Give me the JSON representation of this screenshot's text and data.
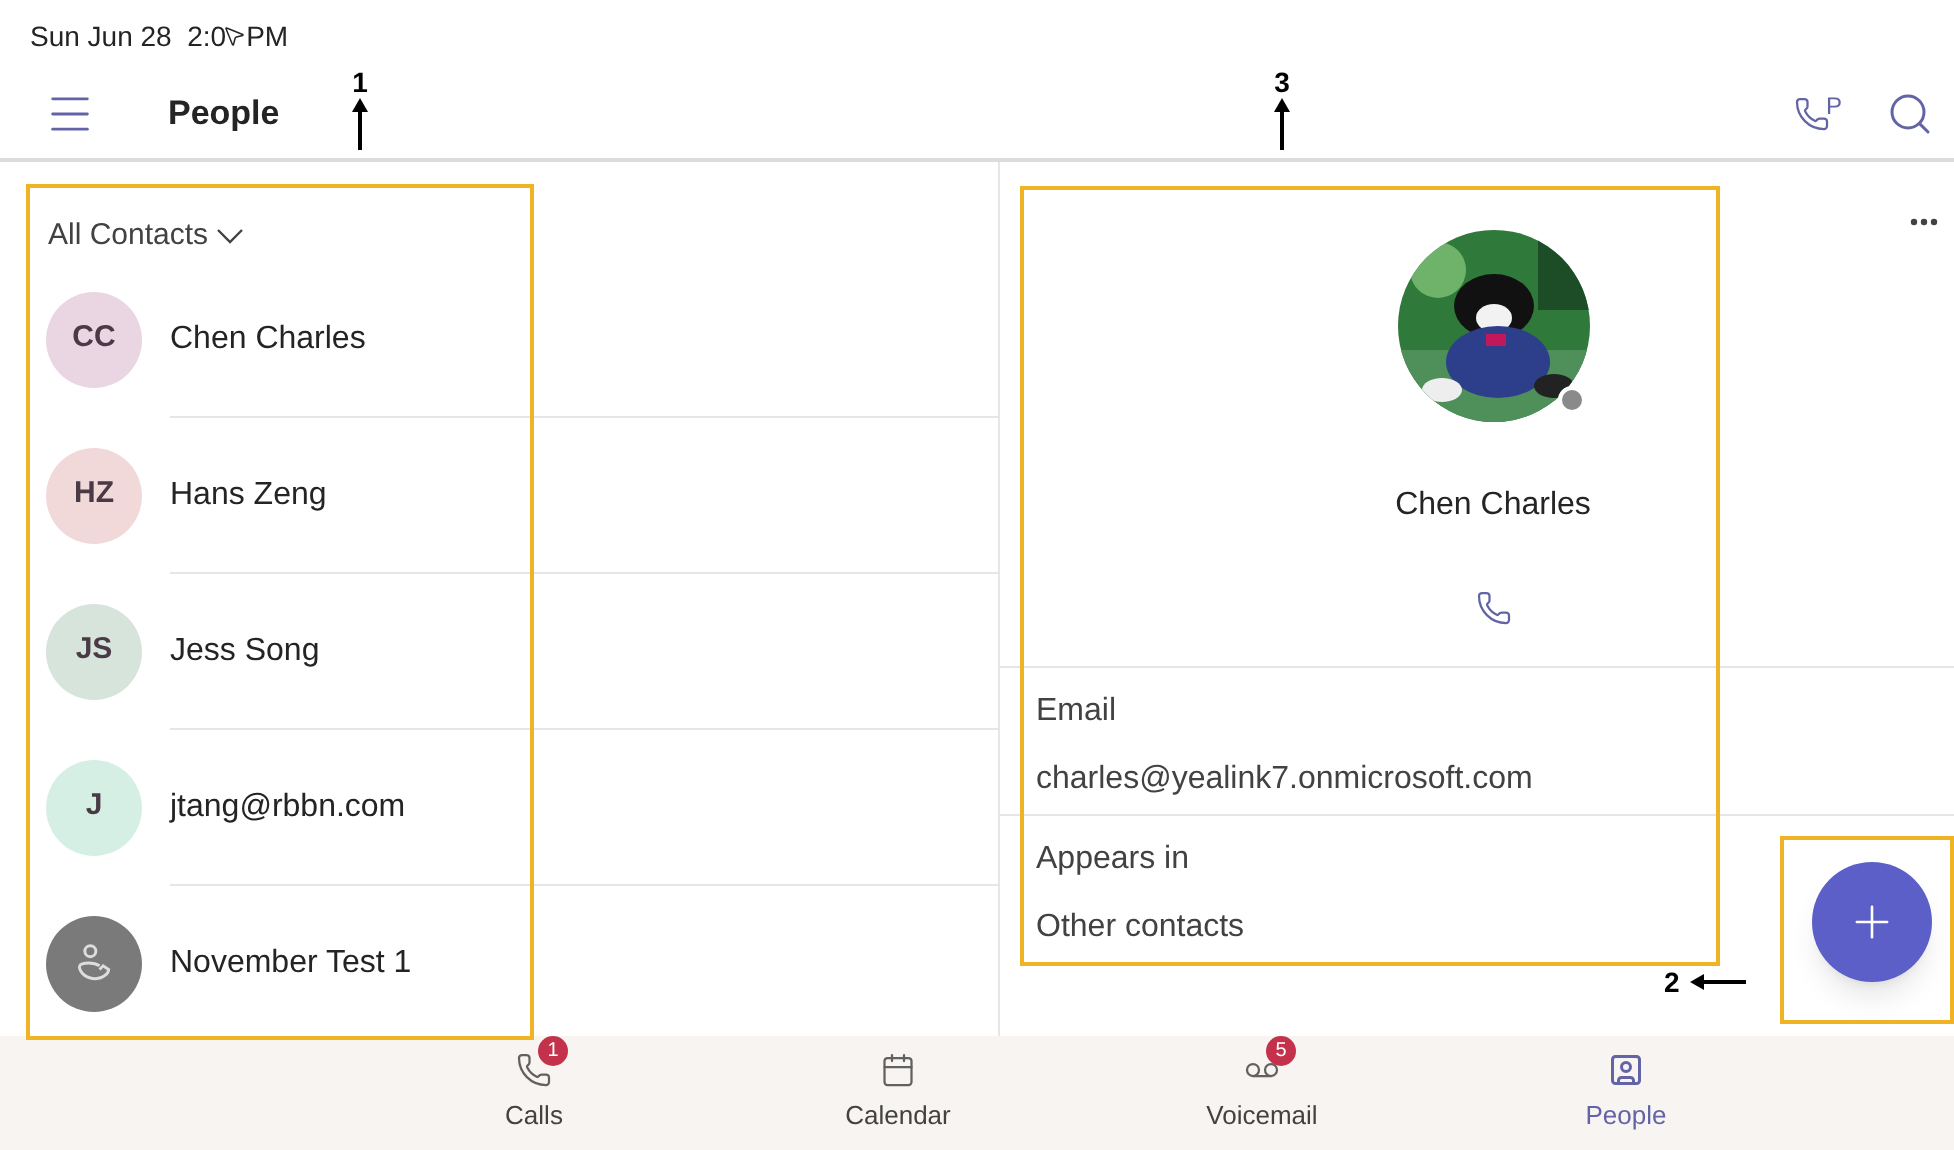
{
  "status_bar": {
    "date_time": "Sun Jun 28  2:0",
    "period": "PM"
  },
  "header": {
    "title": "People",
    "park_label": "P"
  },
  "contacts_panel": {
    "filter": "All Contacts",
    "contacts": [
      {
        "kind": "initials",
        "initials": "CC",
        "name": "Chen Charles",
        "color": "#ead5e3"
      },
      {
        "kind": "initials",
        "initials": "HZ",
        "name": "Hans Zeng",
        "color": "#f2d9d9"
      },
      {
        "kind": "initials",
        "initials": "JS",
        "name": "Jess Song",
        "color": "#d6e4dc"
      },
      {
        "kind": "initials",
        "initials": "J",
        "name": "jtang@rbbn.com",
        "color": "#d6efe4"
      },
      {
        "kind": "icon",
        "name": "November Test 1",
        "color": "#7a7a7a"
      }
    ]
  },
  "detail_panel": {
    "kind": "picture",
    "name": "Chen Charles",
    "fields": [
      {
        "label": "Email",
        "value": "charles@yealink7.onmicrosoft.com"
      },
      {
        "label": "Appears in",
        "value": "Other contacts"
      }
    ]
  },
  "bottom_nav": [
    {
      "label": "Calls",
      "badge": "1",
      "selected": false
    },
    {
      "label": "Calendar",
      "selected": false
    },
    {
      "label": "Voicemail",
      "badge": "5",
      "selected": false
    },
    {
      "label": "People",
      "selected": true
    }
  ],
  "callouts": [
    {
      "label": "1"
    },
    {
      "label": "2"
    },
    {
      "label": "3"
    }
  ]
}
